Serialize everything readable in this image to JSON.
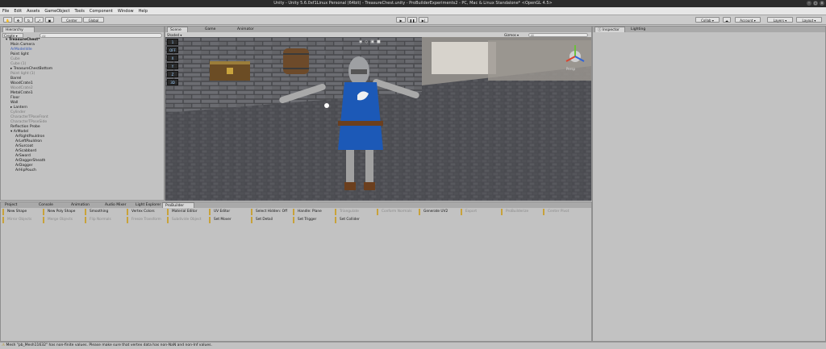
{
  "window": {
    "title": "Unity - Unity 5.6.0xf1Linux Personal (64bit) - TreasureChest.unity - ProBuilderExperiments2 - PC, Mac & Linux Standalone* <OpenGL 4.5>"
  },
  "menu": [
    "File",
    "Edit",
    "Assets",
    "GameObject",
    "Tools",
    "Component",
    "Window",
    "Help"
  ],
  "toolbar": {
    "pivot": "Center",
    "space": "Global",
    "collab": "Collab",
    "account": "Account",
    "layers": "Layers",
    "layout": "Layout"
  },
  "hierarchy": {
    "tab": "Hierarchy",
    "create": "Create",
    "search_placeholder": "All",
    "items": [
      {
        "label": "TreasureChest*",
        "style": "bold"
      },
      {
        "label": "Main Camera",
        "style": "normal"
      },
      {
        "label": "ArModelIdle",
        "style": "blue"
      },
      {
        "label": "Point light",
        "style": "normal"
      },
      {
        "label": "Cube",
        "style": "dim"
      },
      {
        "label": "Cube (1)",
        "style": "dim"
      },
      {
        "label": "TreasureChestBottom",
        "style": "normal"
      },
      {
        "label": "Point light (1)",
        "style": "dim"
      },
      {
        "label": "Barrel",
        "style": "normal"
      },
      {
        "label": "WoodCrate1",
        "style": "normal"
      },
      {
        "label": "WoodCrate2",
        "style": "dim"
      },
      {
        "label": "MetalCrate1",
        "style": "normal"
      },
      {
        "label": "Floor",
        "style": "normal"
      },
      {
        "label": "Wall",
        "style": "normal"
      },
      {
        "label": "Lantern",
        "style": "normal"
      },
      {
        "label": "Cylinder",
        "style": "dim"
      },
      {
        "label": "CharacterTPoseFront",
        "style": "dim"
      },
      {
        "label": "CharacterTPoseSide",
        "style": "dim"
      },
      {
        "label": "Reflection Probe",
        "style": "normal"
      },
      {
        "label": "ArModel",
        "style": "normal"
      },
      {
        "label": "ArRightPauldron",
        "style": "normal"
      },
      {
        "label": "ArLeftPauldron",
        "style": "normal"
      },
      {
        "label": "ArSurcoat",
        "style": "normal"
      },
      {
        "label": "ArScabbard",
        "style": "normal"
      },
      {
        "label": "ArSword",
        "style": "normal"
      },
      {
        "label": "ArDaggerSheath",
        "style": "normal"
      },
      {
        "label": "ArDagger",
        "style": "normal"
      },
      {
        "label": "ArHipPouch",
        "style": "normal"
      }
    ]
  },
  "center_tabs": [
    "Scene",
    "Game",
    "Animator"
  ],
  "scene": {
    "shading": "Shaded",
    "gizmos": "Gizmos",
    "search_placeholder": "All",
    "persp_label": "Persp",
    "side_buttons": [
      "1",
      "OFF",
      "X",
      "Y",
      "Z",
      "3D"
    ]
  },
  "inspector_tabs": [
    "Inspector",
    "Lighting"
  ],
  "bottom_tabs": [
    "Project",
    "Console",
    "Animation",
    "Audio Mixer",
    "Light Explorer",
    "ProBuilder"
  ],
  "probuilder": {
    "row1": [
      {
        "label": "New Shape",
        "dim": false
      },
      {
        "label": "New Poly Shape",
        "dim": false
      },
      {
        "label": "Smoothing",
        "dim": false
      },
      {
        "label": "Vertex Colors",
        "dim": false
      },
      {
        "label": "Material Editor",
        "dim": false
      },
      {
        "label": "UV Editor",
        "dim": false
      },
      {
        "label": "Select Hidden: Off",
        "dim": false
      },
      {
        "label": "Handle: Plane",
        "dim": false
      },
      {
        "label": "Triangulate",
        "dim": true
      },
      {
        "label": "Conform Normals",
        "dim": true
      },
      {
        "label": "Generate UV2",
        "dim": false
      },
      {
        "label": "Export",
        "dim": true
      },
      {
        "label": "ProBuilderize",
        "dim": true
      },
      {
        "label": "Center Pivot",
        "dim": true
      }
    ],
    "row2": [
      {
        "label": "Mirror Objects",
        "dim": true
      },
      {
        "label": "Merge Objects",
        "dim": true
      },
      {
        "label": "Flip Normals",
        "dim": true
      },
      {
        "label": "Freeze Transform",
        "dim": true
      },
      {
        "label": "Subdivide Object",
        "dim": true
      },
      {
        "label": "Set Mover",
        "dim": false
      },
      {
        "label": "Set Detail",
        "dim": false
      },
      {
        "label": "Set Trigger",
        "dim": false
      },
      {
        "label": "Set Collider",
        "dim": false
      }
    ]
  },
  "status": "Mesh \"pb_Mesh11632\" has non-finite values. Please make sure that vertex data has non-NaN and non-Inf values.",
  "colors": {
    "accent_gold": "#c8a23a",
    "selection_blue": "#3458b8"
  }
}
